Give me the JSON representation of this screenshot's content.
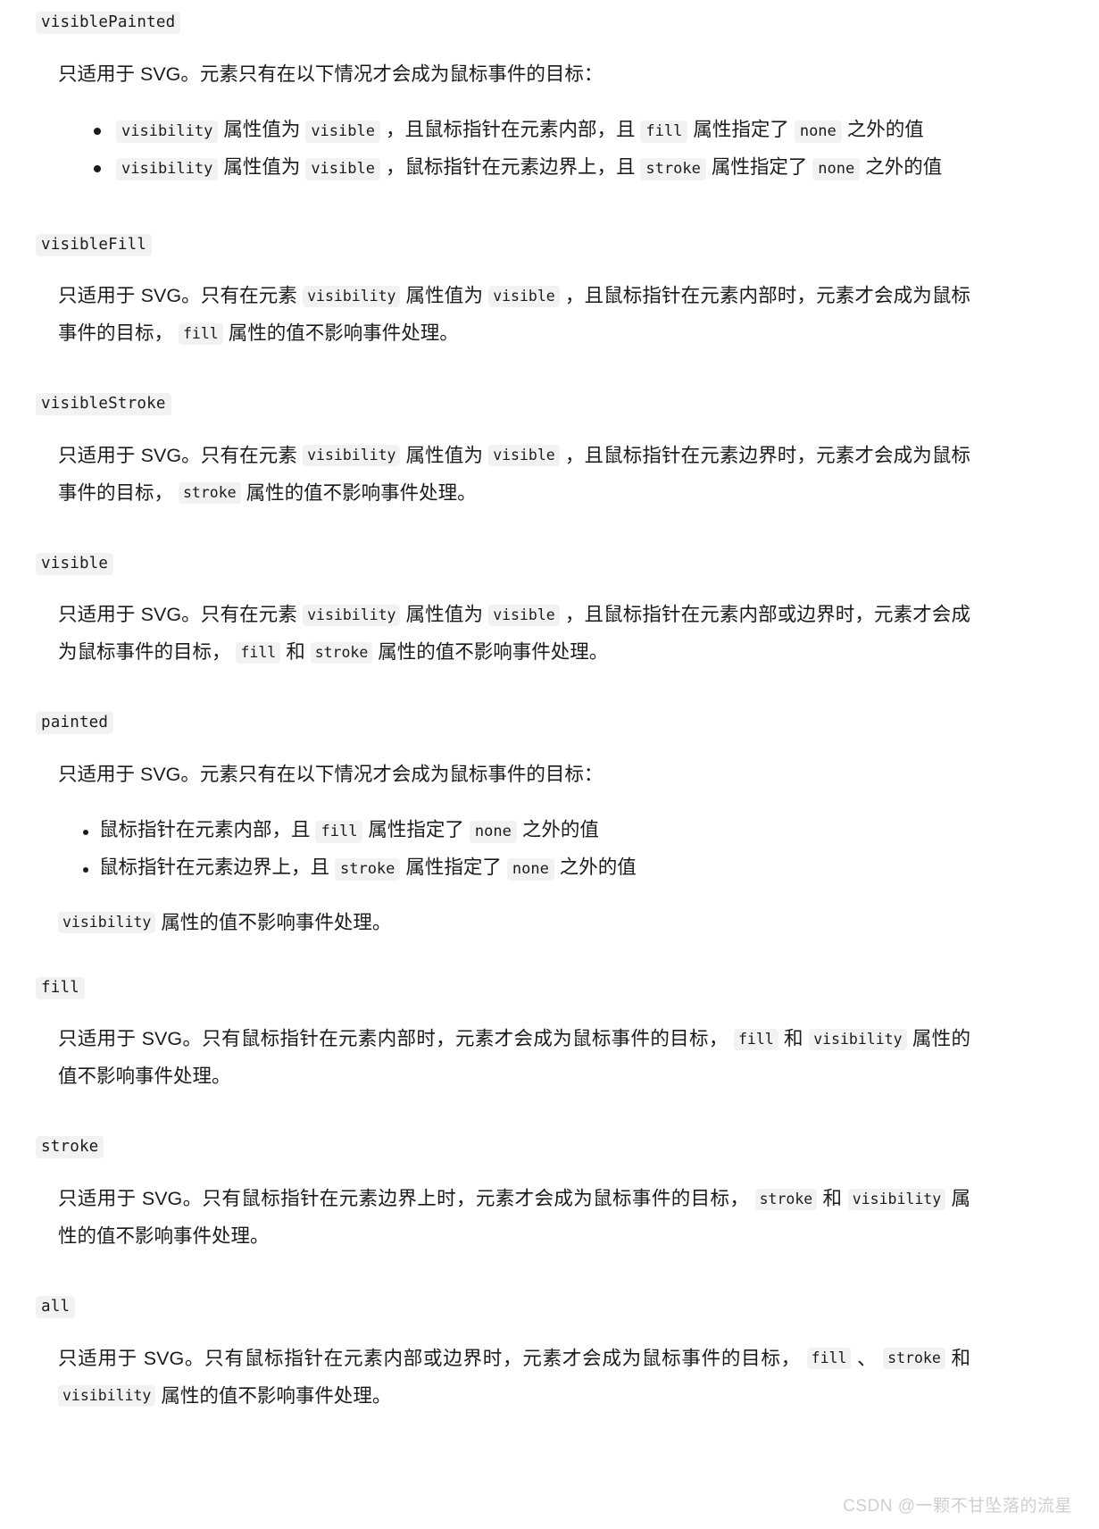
{
  "doc": {
    "watermark": "CSDN @一颗不甘坠落的流星",
    "chip_bg": "#f2f2f2",
    "text_color": "#1b1b1b",
    "watermark_color": "#cfcfcf"
  },
  "sections": [
    {
      "term": "visiblePainted",
      "intro": "只适用于 SVG。元素只有在以下情况才会成为鼠标事件的目标：",
      "bullets": [
        {
          "parts": [
            {
              "type": "code",
              "text": "visibility"
            },
            {
              "type": "text",
              "text": " 属性值为 "
            },
            {
              "type": "code",
              "text": "visible"
            },
            {
              "type": "text",
              "text": " ，且鼠标指针在元素内部，且 "
            },
            {
              "type": "code",
              "text": "fill"
            },
            {
              "type": "text",
              "text": " 属性指定了 "
            },
            {
              "type": "code",
              "text": "none"
            },
            {
              "type": "text",
              "text": " 之外的值"
            }
          ]
        },
        {
          "parts": [
            {
              "type": "code",
              "text": "visibility"
            },
            {
              "type": "text",
              "text": " 属性值为 "
            },
            {
              "type": "code",
              "text": "visible"
            },
            {
              "type": "text",
              "text": " ，鼠标指针在元素边界上，且 "
            },
            {
              "type": "code",
              "text": "stroke"
            },
            {
              "type": "text",
              "text": " 属性指定了 "
            },
            {
              "type": "code",
              "text": "none"
            },
            {
              "type": "text",
              "text": " 之外的值"
            }
          ]
        }
      ]
    },
    {
      "term": "visibleFill",
      "paragraph": [
        {
          "type": "text",
          "text": "只适用于 SVG。只有在元素 "
        },
        {
          "type": "code",
          "text": "visibility"
        },
        {
          "type": "text",
          "text": " 属性值为 "
        },
        {
          "type": "code",
          "text": "visible"
        },
        {
          "type": "text",
          "text": " ，且鼠标指针在元素内部时，元素才会成为鼠标事件的目标， "
        },
        {
          "type": "code",
          "text": "fill"
        },
        {
          "type": "text",
          "text": " 属性的值不影响事件处理。"
        }
      ]
    },
    {
      "term": "visibleStroke",
      "paragraph": [
        {
          "type": "text",
          "text": "只适用于 SVG。只有在元素 "
        },
        {
          "type": "code",
          "text": "visibility"
        },
        {
          "type": "text",
          "text": " 属性值为 "
        },
        {
          "type": "code",
          "text": "visible"
        },
        {
          "type": "text",
          "text": " ，且鼠标指针在元素边界时，元素才会成为鼠标事件的目标， "
        },
        {
          "type": "code",
          "text": "stroke"
        },
        {
          "type": "text",
          "text": " 属性的值不影响事件处理。"
        }
      ]
    },
    {
      "term": "visible",
      "paragraph": [
        {
          "type": "text",
          "text": "只适用于 SVG。只有在元素 "
        },
        {
          "type": "code",
          "text": "visibility"
        },
        {
          "type": "text",
          "text": " 属性值为 "
        },
        {
          "type": "code",
          "text": "visible"
        },
        {
          "type": "text",
          "text": " ，且鼠标指针在元素内部或边界时，元素才会成为鼠标事件的目标， "
        },
        {
          "type": "code",
          "text": "fill"
        },
        {
          "type": "text",
          "text": " 和 "
        },
        {
          "type": "code",
          "text": "stroke"
        },
        {
          "type": "text",
          "text": " 属性的值不影响事件处理。"
        }
      ]
    },
    {
      "term": "painted",
      "intro": "只适用于 SVG。元素只有在以下情况才会成为鼠标事件的目标：",
      "bullets": [
        {
          "parts": [
            {
              "type": "text",
              "text": "鼠标指针在元素内部，且 "
            },
            {
              "type": "code",
              "text": "fill"
            },
            {
              "type": "text",
              "text": " 属性指定了 "
            },
            {
              "type": "code",
              "text": "none"
            },
            {
              "type": "text",
              "text": " 之外的值"
            }
          ]
        },
        {
          "parts": [
            {
              "type": "text",
              "text": "鼠标指针在元素边界上，且 "
            },
            {
              "type": "code",
              "text": "stroke"
            },
            {
              "type": "text",
              "text": " 属性指定了 "
            },
            {
              "type": "code",
              "text": "none"
            },
            {
              "type": "text",
              "text": " 之外的值"
            }
          ]
        }
      ],
      "note": [
        {
          "type": "code",
          "text": "visibility"
        },
        {
          "type": "text",
          "text": " 属性的值不影响事件处理。"
        }
      ]
    },
    {
      "term": "fill",
      "paragraph": [
        {
          "type": "text",
          "text": "只适用于 SVG。只有鼠标指针在元素内部时，元素才会成为鼠标事件的目标， "
        },
        {
          "type": "code",
          "text": "fill"
        },
        {
          "type": "text",
          "text": " 和 "
        },
        {
          "type": "code",
          "text": "visibility"
        },
        {
          "type": "text",
          "text": " 属性的值不影响事件处理。"
        }
      ]
    },
    {
      "term": "stroke",
      "paragraph": [
        {
          "type": "text",
          "text": "只适用于 SVG。只有鼠标指针在元素边界上时，元素才会成为鼠标事件的目标， "
        },
        {
          "type": "code",
          "text": "stroke"
        },
        {
          "type": "text",
          "text": " 和 "
        },
        {
          "type": "code",
          "text": "visibility"
        },
        {
          "type": "text",
          "text": " 属性的值不影响事件处理。"
        }
      ]
    },
    {
      "term": "all",
      "paragraph": [
        {
          "type": "text",
          "text": "只适用于 SVG。只有鼠标指针在元素内部或边界时，元素才会成为鼠标事件的目标， "
        },
        {
          "type": "code",
          "text": "fill"
        },
        {
          "type": "text",
          "text": " 、 "
        },
        {
          "type": "code",
          "text": "stroke"
        },
        {
          "type": "text",
          "text": " 和 "
        },
        {
          "type": "code",
          "text": "visibility"
        },
        {
          "type": "text",
          "text": " 属性的值不影响事件处理。"
        }
      ]
    }
  ]
}
